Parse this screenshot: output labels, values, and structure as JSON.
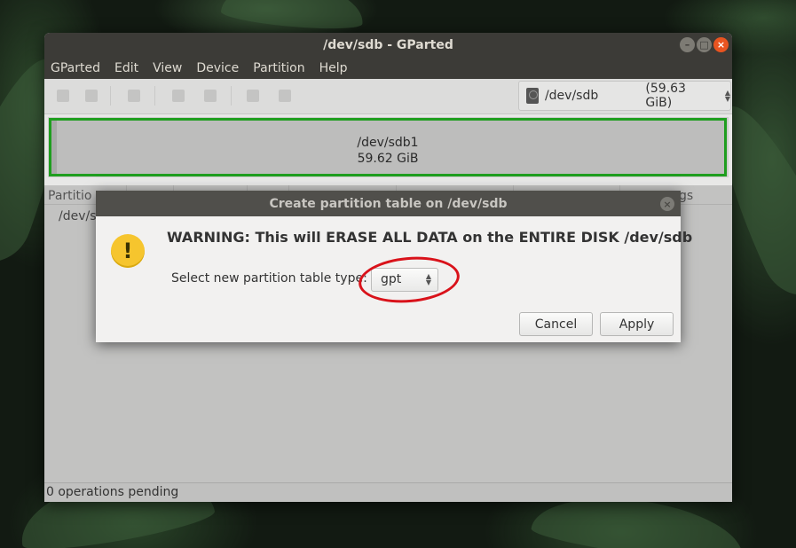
{
  "window": {
    "title": "/dev/sdb - GParted",
    "menu": [
      "GParted",
      "Edit",
      "View",
      "Device",
      "Partition",
      "Help"
    ],
    "device_selector": {
      "name": "/dev/sdb",
      "size": "(59.63 GiB)"
    }
  },
  "graphic": {
    "partition_name": "/dev/sdb1",
    "partition_size": "59.62 GiB"
  },
  "list": {
    "visible_header": "Partitio",
    "header_right": "gs",
    "visible_row": "/dev/s"
  },
  "status": "0 operations pending",
  "dialog": {
    "title": "Create partition table on /dev/sdb",
    "warning": "WARNING:  This will ERASE ALL DATA on the ENTIRE DISK /dev/sdb",
    "select_label": "Select new partition table type:",
    "selected_type": "gpt",
    "cancel_label": "Cancel",
    "apply_label": "Apply"
  },
  "colors": {
    "warning_icon": "#f6c52e",
    "annotation_circle": "#d9121a",
    "partition_border": "#1f9e1f"
  }
}
